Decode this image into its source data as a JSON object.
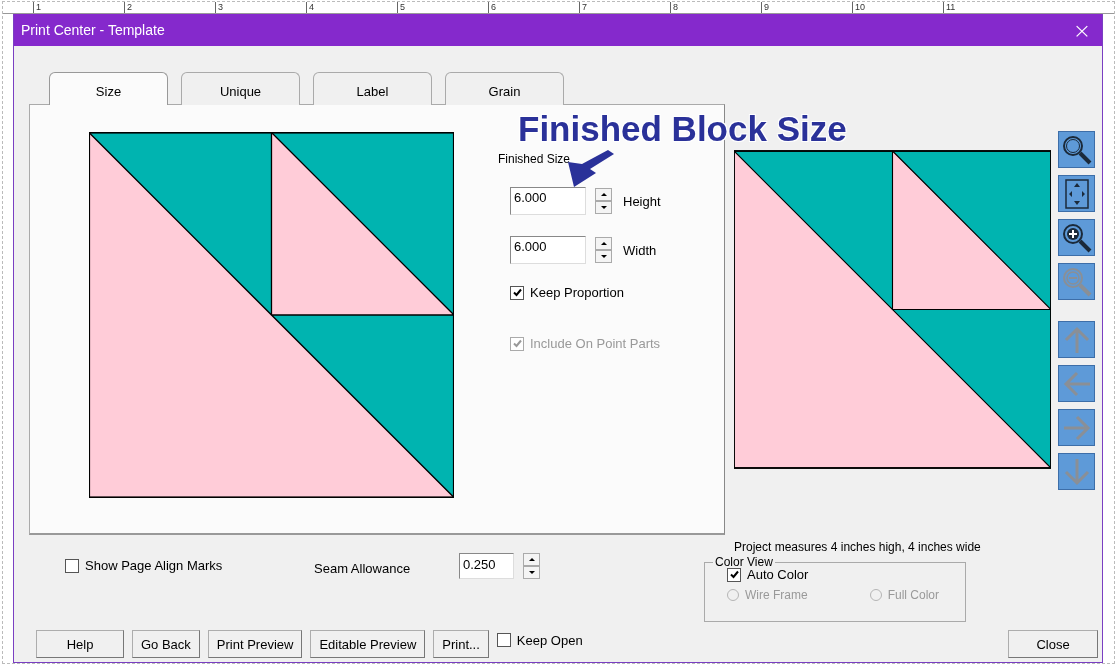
{
  "ruler": {
    "labels": [
      "1",
      "2",
      "3",
      "4",
      "5",
      "6",
      "7",
      "8",
      "9",
      "10",
      "11"
    ]
  },
  "window": {
    "title": "Print Center - Template",
    "close": "×"
  },
  "tabs": [
    {
      "label": "Size",
      "selected": true
    },
    {
      "label": "Unique",
      "selected": false
    },
    {
      "label": "Label",
      "selected": false
    },
    {
      "label": "Grain",
      "selected": false
    }
  ],
  "finished_size": {
    "heading": "Finished Size",
    "fields": [
      {
        "label": "Height",
        "value": "6.000"
      },
      {
        "label": "Width",
        "value": "6.000"
      }
    ],
    "checkboxes": [
      {
        "label": "Keep Proportion",
        "checked": true,
        "disabled": false
      },
      {
        "label": "Include On Point Parts",
        "checked": true,
        "disabled": true
      }
    ]
  },
  "callout": {
    "text": "Finished Block Size"
  },
  "toolbar": [
    {
      "kind": "zoom",
      "disabled": false
    },
    {
      "kind": "fit",
      "disabled": false
    },
    {
      "kind": "zoom_in",
      "disabled": false
    },
    {
      "kind": "zoom_out",
      "disabled": true
    },
    {
      "kind": "up",
      "disabled": true
    },
    {
      "kind": "left",
      "disabled": true
    },
    {
      "kind": "right",
      "disabled": true
    },
    {
      "kind": "down",
      "disabled": true
    }
  ],
  "project_measure": "Project measures 4 inches high, 4 inches wide",
  "align_marks": {
    "label": "Show Page Align Marks",
    "checked": false
  },
  "seam_allowance": {
    "label": "Seam Allowance",
    "value": "0.250"
  },
  "color_view": {
    "title": "Color View",
    "auto_color": {
      "label": "Auto Color",
      "checked": true
    },
    "options": [
      {
        "label": "Wire Frame",
        "selected": false,
        "disabled": true
      },
      {
        "label": "Full Color",
        "selected": false,
        "disabled": true
      }
    ]
  },
  "buttons": [
    {
      "label": "Help"
    },
    {
      "label": "Go Back"
    },
    {
      "label": "Print Preview"
    },
    {
      "label": "Editable Preview"
    },
    {
      "label": "Print..."
    }
  ],
  "keep_open": {
    "label": "Keep Open",
    "checked": false
  },
  "close_button": {
    "label": "Close"
  }
}
